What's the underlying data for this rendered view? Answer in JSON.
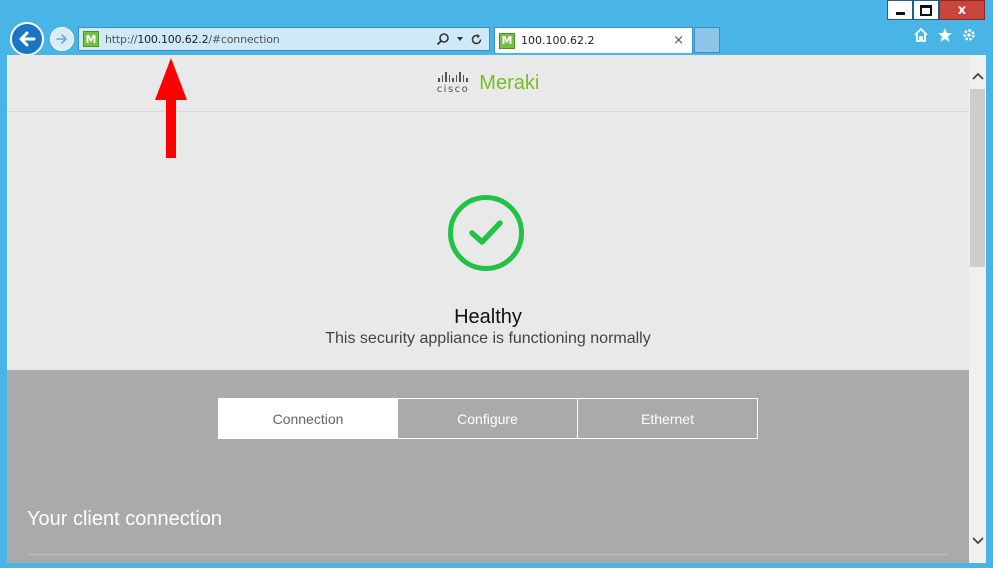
{
  "window": {
    "minimize_icon": "minimize-icon",
    "maximize_icon": "maximize-icon",
    "close_label": "x"
  },
  "browser": {
    "address": {
      "prefix": "http://",
      "host": "100.100.62.2",
      "path": "/#connection",
      "favicon_letter": "M"
    },
    "tab": {
      "title": "100.100.62.2",
      "favicon_letter": "M",
      "close_label": "×"
    }
  },
  "page": {
    "brand": {
      "cisco": "cisco",
      "meraki": "Meraki"
    },
    "status": {
      "title": "Healthy",
      "subtitle": "This security appliance is functioning normally"
    },
    "tabs": [
      {
        "label": "Connection",
        "active": true
      },
      {
        "label": "Configure",
        "active": false
      },
      {
        "label": "Ethernet",
        "active": false
      }
    ],
    "section_heading": "Your client connection"
  },
  "colors": {
    "accent": "#78be20",
    "success": "#21c245",
    "section_bg": "#aaaaaa",
    "annotation": "#ff0000"
  }
}
